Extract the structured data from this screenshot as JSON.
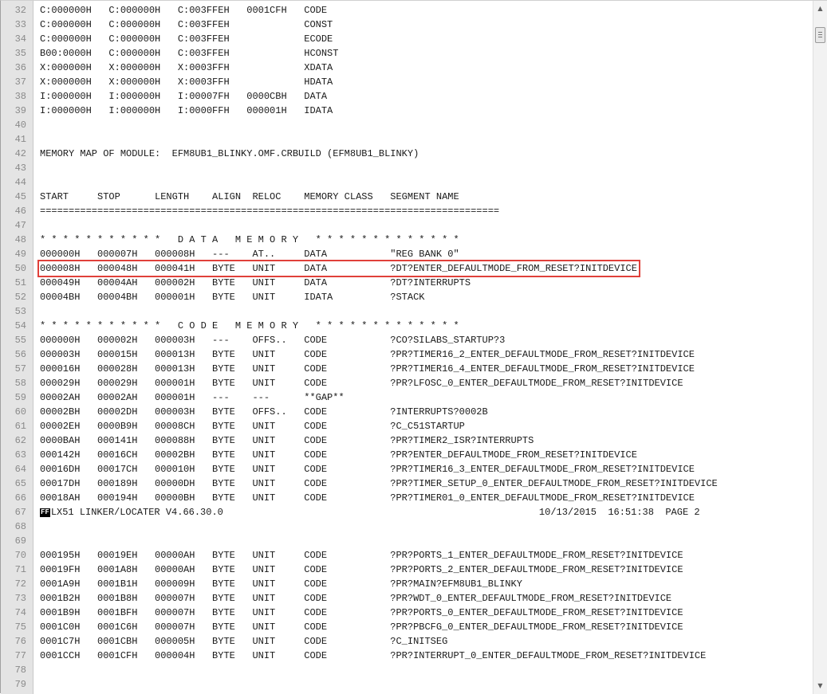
{
  "editor": {
    "highlighted_line": 50,
    "lines": [
      {
        "n": "32",
        "t": "C:000000H   C:000000H   C:003FFEH   0001CFH   CODE"
      },
      {
        "n": "33",
        "t": "C:000000H   C:000000H   C:003FFEH             CONST"
      },
      {
        "n": "34",
        "t": "C:000000H   C:000000H   C:003FFEH             ECODE"
      },
      {
        "n": "35",
        "t": "B00:0000H   C:000000H   C:003FFEH             HCONST"
      },
      {
        "n": "36",
        "t": "X:000000H   X:000000H   X:0003FFH             XDATA"
      },
      {
        "n": "37",
        "t": "X:000000H   X:000000H   X:0003FFH             HDATA"
      },
      {
        "n": "38",
        "t": "I:000000H   I:000000H   I:00007FH   0000CBH   DATA"
      },
      {
        "n": "39",
        "t": "I:000000H   I:000000H   I:0000FFH   000001H   IDATA"
      },
      {
        "n": "40",
        "t": ""
      },
      {
        "n": "41",
        "t": ""
      },
      {
        "n": "42",
        "t": "MEMORY MAP OF MODULE:  EFM8UB1_BLINKY.OMF.CRBUILD (EFM8UB1_BLINKY)"
      },
      {
        "n": "43",
        "t": ""
      },
      {
        "n": "44",
        "t": ""
      },
      {
        "n": "45",
        "t": "START     STOP      LENGTH    ALIGN  RELOC    MEMORY CLASS   SEGMENT NAME"
      },
      {
        "n": "46",
        "t": "================================================================================"
      },
      {
        "n": "47",
        "t": ""
      },
      {
        "n": "48",
        "t": "* * * * * * * * * * *   D A T A   M E M O R Y   * * * * * * * * * * * * *"
      },
      {
        "n": "49",
        "t": "000000H   000007H   000008H   ---    AT..     DATA           \"REG BANK 0\""
      },
      {
        "n": "50",
        "t": "000008H   000048H   000041H   BYTE   UNIT     DATA           ?DT?ENTER_DEFAULTMODE_FROM_RESET?INITDEVICE"
      },
      {
        "n": "51",
        "t": "000049H   00004AH   000002H   BYTE   UNIT     DATA           ?DT?INTERRUPTS"
      },
      {
        "n": "52",
        "t": "00004BH   00004BH   000001H   BYTE   UNIT     IDATA          ?STACK"
      },
      {
        "n": "53",
        "t": ""
      },
      {
        "n": "54",
        "t": "* * * * * * * * * * *   C O D E   M E M O R Y   * * * * * * * * * * * * *"
      },
      {
        "n": "55",
        "t": "000000H   000002H   000003H   ---    OFFS..   CODE           ?CO?SILABS_STARTUP?3"
      },
      {
        "n": "56",
        "t": "000003H   000015H   000013H   BYTE   UNIT     CODE           ?PR?TIMER16_2_ENTER_DEFAULTMODE_FROM_RESET?INITDEVICE"
      },
      {
        "n": "57",
        "t": "000016H   000028H   000013H   BYTE   UNIT     CODE           ?PR?TIMER16_4_ENTER_DEFAULTMODE_FROM_RESET?INITDEVICE"
      },
      {
        "n": "58",
        "t": "000029H   000029H   000001H   BYTE   UNIT     CODE           ?PR?LFOSC_0_ENTER_DEFAULTMODE_FROM_RESET?INITDEVICE"
      },
      {
        "n": "59",
        "t": "00002AH   00002AH   000001H   ---    ---      **GAP**"
      },
      {
        "n": "60",
        "t": "00002BH   00002DH   000003H   BYTE   OFFS..   CODE           ?INTERRUPTS?0002B"
      },
      {
        "n": "61",
        "t": "00002EH   0000B9H   00008CH   BYTE   UNIT     CODE           ?C_C51STARTUP"
      },
      {
        "n": "62",
        "t": "0000BAH   000141H   000088H   BYTE   UNIT     CODE           ?PR?TIMER2_ISR?INTERRUPTS"
      },
      {
        "n": "63",
        "t": "000142H   00016CH   00002BH   BYTE   UNIT     CODE           ?PR?ENTER_DEFAULTMODE_FROM_RESET?INITDEVICE"
      },
      {
        "n": "64",
        "t": "00016DH   00017CH   000010H   BYTE   UNIT     CODE           ?PR?TIMER16_3_ENTER_DEFAULTMODE_FROM_RESET?INITDEVICE"
      },
      {
        "n": "65",
        "t": "00017DH   000189H   00000DH   BYTE   UNIT     CODE           ?PR?TIMER_SETUP_0_ENTER_DEFAULTMODE_FROM_RESET?INITDEVICE"
      },
      {
        "n": "66",
        "t": "00018AH   000194H   00000BH   BYTE   UNIT     CODE           ?PR?TIMER01_0_ENTER_DEFAULTMODE_FROM_RESET?INITDEVICE"
      },
      {
        "n": "67",
        "t": "LX51 LINKER/LOCATER V4.66.30.0                                                       10/13/2015  16:51:38  PAGE 2",
        "ff": "FF"
      },
      {
        "n": "68",
        "t": ""
      },
      {
        "n": "69",
        "t": ""
      },
      {
        "n": "70",
        "t": "000195H   00019EH   00000AH   BYTE   UNIT     CODE           ?PR?PORTS_1_ENTER_DEFAULTMODE_FROM_RESET?INITDEVICE"
      },
      {
        "n": "71",
        "t": "00019FH   0001A8H   00000AH   BYTE   UNIT     CODE           ?PR?PORTS_2_ENTER_DEFAULTMODE_FROM_RESET?INITDEVICE"
      },
      {
        "n": "72",
        "t": "0001A9H   0001B1H   000009H   BYTE   UNIT     CODE           ?PR?MAIN?EFM8UB1_BLINKY"
      },
      {
        "n": "73",
        "t": "0001B2H   0001B8H   000007H   BYTE   UNIT     CODE           ?PR?WDT_0_ENTER_DEFAULTMODE_FROM_RESET?INITDEVICE"
      },
      {
        "n": "74",
        "t": "0001B9H   0001BFH   000007H   BYTE   UNIT     CODE           ?PR?PORTS_0_ENTER_DEFAULTMODE_FROM_RESET?INITDEVICE"
      },
      {
        "n": "75",
        "t": "0001C0H   0001C6H   000007H   BYTE   UNIT     CODE           ?PR?PBCFG_0_ENTER_DEFAULTMODE_FROM_RESET?INITDEVICE"
      },
      {
        "n": "76",
        "t": "0001C7H   0001CBH   000005H   BYTE   UNIT     CODE           ?C_INITSEG"
      },
      {
        "n": "77",
        "t": "0001CCH   0001CFH   000004H   BYTE   UNIT     CODE           ?PR?INTERRUPT_0_ENTER_DEFAULTMODE_FROM_RESET?INITDEVICE"
      },
      {
        "n": "78",
        "t": ""
      },
      {
        "n": "79",
        "t": ""
      }
    ]
  },
  "scrollbar": {
    "up_icon": "▲",
    "down_icon": "▼",
    "position_fraction": 0.03
  },
  "colors": {
    "highlight_border": "#e0403a",
    "gutter": "#e4e4e4"
  }
}
